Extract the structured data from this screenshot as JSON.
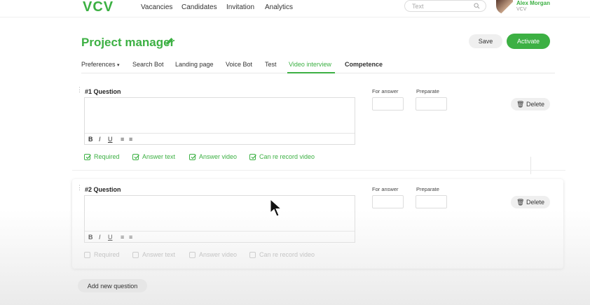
{
  "nav": {
    "logo": "VCV",
    "items": [
      "Vacancies",
      "Candidates",
      "Invitation",
      "Analytics"
    ],
    "search_placeholder": "Text",
    "user_name": "Alex Morgan",
    "user_org": "VCV"
  },
  "header": {
    "title": "Project manager",
    "save_label": "Save",
    "activate_label": "Activate"
  },
  "tabs": [
    {
      "label": "Preferences",
      "has_dropdown": true
    },
    {
      "label": "Search Bot"
    },
    {
      "label": "Landing page"
    },
    {
      "label": "Voice Bot"
    },
    {
      "label": "Test"
    },
    {
      "label": "Video interview",
      "active": true
    },
    {
      "label": "Competence"
    }
  ],
  "questions": [
    {
      "label": "#1 Question",
      "for_answer_label": "For answer",
      "preparate_label": "Preparate",
      "delete_label": "Delete",
      "format": {
        "bold": "B",
        "italic": "I",
        "underline": "U"
      },
      "options": [
        {
          "label": "Required",
          "checked": true
        },
        {
          "label": "Answer text",
          "checked": true
        },
        {
          "label": "Answer video",
          "checked": true
        },
        {
          "label": "Can re record video",
          "checked": true
        }
      ]
    },
    {
      "label": "#2 Question",
      "for_answer_label": "For answer",
      "preparate_label": "Preparate",
      "delete_label": "Delete",
      "format": {
        "bold": "B",
        "italic": "I",
        "underline": "U"
      },
      "options": [
        {
          "label": "Required",
          "checked": false
        },
        {
          "label": "Answer text",
          "checked": false
        },
        {
          "label": "Answer video",
          "checked": false
        },
        {
          "label": "Can re record video",
          "checked": false
        }
      ]
    }
  ],
  "add_question_label": "Add new question",
  "colors": {
    "accent": "#3cb043",
    "text": "#222222",
    "muted": "#aaaaaa"
  }
}
